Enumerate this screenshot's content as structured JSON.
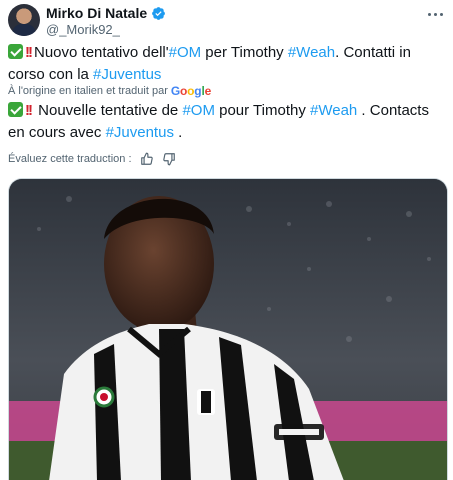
{
  "author": {
    "name": "Mirko Di Natale",
    "handle": "@_Morik92_",
    "verified": true
  },
  "original": {
    "seg1": "Nuovo tentativo dell'",
    "tag_om": "#OM",
    "seg2": " per Timothy ",
    "tag_weah": "#Weah",
    "seg3": ". Contatti in corso con la ",
    "tag_juve": "#Juventus"
  },
  "translation_source": {
    "text": "À l'origine en italien et traduit par",
    "provider": "Google"
  },
  "translated": {
    "seg1": " Nouvelle tentative de ",
    "tag_om": "#OM",
    "seg2": " pour Timothy ",
    "tag_weah": "#Weah",
    "seg3": " . Contacts en cours avec ",
    "tag_juve": "#Juventus",
    "seg4": " ."
  },
  "rate_translation": {
    "label": "Évaluez cette traduction :"
  },
  "icons": [
    "verified-badge-icon",
    "more-options-icon",
    "check-mark-emoji-icon",
    "double-exclamation-emoji-icon",
    "thumbs-up-icon",
    "thumbs-down-icon"
  ],
  "colors": {
    "link": "#1d9bf0",
    "text": "#0f1419",
    "secondary": "#536471",
    "verified": "#1d9bf0"
  }
}
